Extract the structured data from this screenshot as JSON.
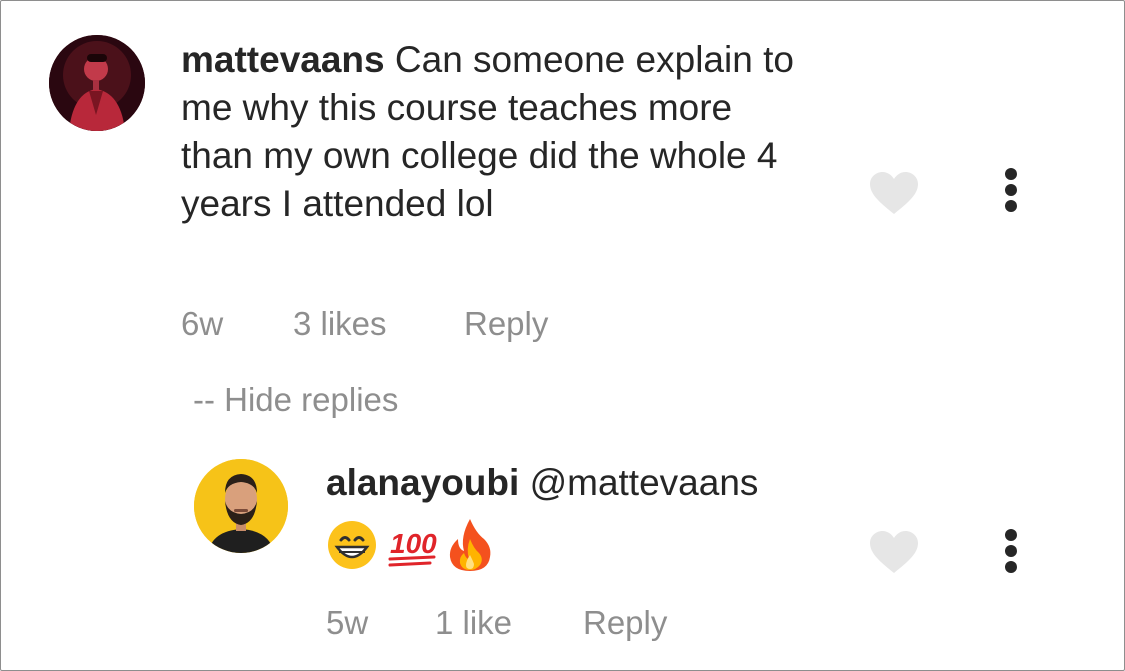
{
  "comment": {
    "username": "mattevaans",
    "text": "Can someone explain to me why this course teaches more than my own college did the whole 4 years I attended lol",
    "time": "6w",
    "likes": "3 likes",
    "reply_label": "Reply"
  },
  "hide_replies": "-- Hide replies",
  "reply": {
    "username": "alanayoubi",
    "mention": "@mattevaans",
    "emojis": [
      "grinning-face",
      "hundred-points",
      "fire"
    ],
    "time": "5w",
    "likes": "1 like",
    "reply_label": "Reply"
  },
  "colors": {
    "text": "#262626",
    "secondary": "#8e8e8e",
    "heart": "#e6e6e6"
  }
}
